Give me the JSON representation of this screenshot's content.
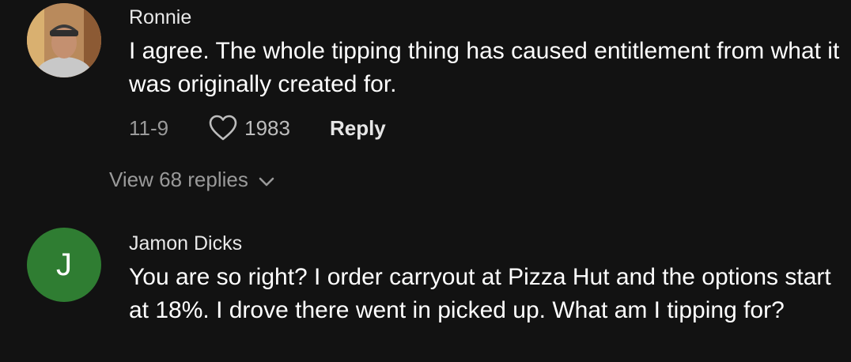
{
  "comments": [
    {
      "username": "Ronnie",
      "text": "I agree. The whole tipping thing has caused entitlement from what it was originally created for.",
      "date": "11-9",
      "likes": "1983",
      "reply_label": "Reply",
      "view_replies_label": "View 68 replies",
      "avatar_icon": "user-photo-icon"
    },
    {
      "username": "Jamon Dicks",
      "text": "You are so right? I order carryout at Pizza Hut and the options start at 18%. I drove there went in picked up. What am I tipping for?",
      "avatar_initial": "J",
      "avatar_color": "#2f7d32"
    }
  ],
  "icons": {
    "like": "heart-icon",
    "expand": "chevron-down-icon"
  }
}
